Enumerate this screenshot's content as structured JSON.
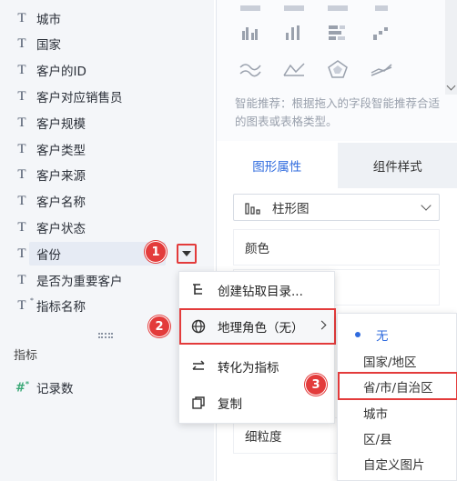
{
  "field_list": {
    "dimensions": [
      {
        "label": "城市",
        "type_icon": "text-field-icon"
      },
      {
        "label": "国家",
        "type_icon": "text-field-icon"
      },
      {
        "label": "客户的ID",
        "type_icon": "text-field-icon"
      },
      {
        "label": "客户对应销售员",
        "type_icon": "text-field-icon"
      },
      {
        "label": "客户规模",
        "type_icon": "text-field-icon"
      },
      {
        "label": "客户类型",
        "type_icon": "text-field-icon"
      },
      {
        "label": "客户来源",
        "type_icon": "text-field-icon"
      },
      {
        "label": "客户名称",
        "type_icon": "text-field-icon"
      },
      {
        "label": "客户状态",
        "type_icon": "text-field-icon"
      },
      {
        "label": "省份",
        "type_icon": "text-field-icon",
        "active": true
      },
      {
        "label": "是否为重要客户",
        "type_icon": "text-field-icon"
      },
      {
        "label": "指标名称",
        "type_icon": "text-field-icon"
      }
    ],
    "measures_title": "指标",
    "measures": [
      {
        "label": "记录数",
        "type_icon": "measure-field-icon"
      }
    ]
  },
  "smart_tip": "智能推荐：根据拖入的字段智能推荐合适的图表或表格类型。",
  "tabs": [
    {
      "label": "图形属性",
      "active": true
    },
    {
      "label": "组件样式",
      "active": false
    }
  ],
  "chart_type_select": {
    "value": "柱形图"
  },
  "properties": {
    "color_label": "颜色",
    "granularity_label": "细粒度"
  },
  "context_menu": {
    "items": [
      {
        "label": "创建钻取目录...",
        "icon": "drill-tree-icon"
      },
      {
        "label": "地理角色（无）",
        "icon": "globe-icon",
        "has_submenu": true,
        "selected": true
      },
      {
        "label": "转化为指标",
        "icon": "swap-icon"
      },
      {
        "label": "复制",
        "icon": "copy-icon"
      }
    ]
  },
  "geo_submenu": {
    "items": [
      {
        "label": "无",
        "checked": true
      },
      {
        "label": "国家/地区"
      },
      {
        "label": "省/市/自治区",
        "selected": true
      },
      {
        "label": "城市"
      },
      {
        "label": "区/县"
      },
      {
        "label": "自定义图片"
      }
    ]
  },
  "badges": [
    "1",
    "2",
    "3"
  ],
  "colors": {
    "accent": "#2f6bde",
    "annotation_red": "#e33b3b",
    "panel_bg": "#f4f6f9"
  }
}
